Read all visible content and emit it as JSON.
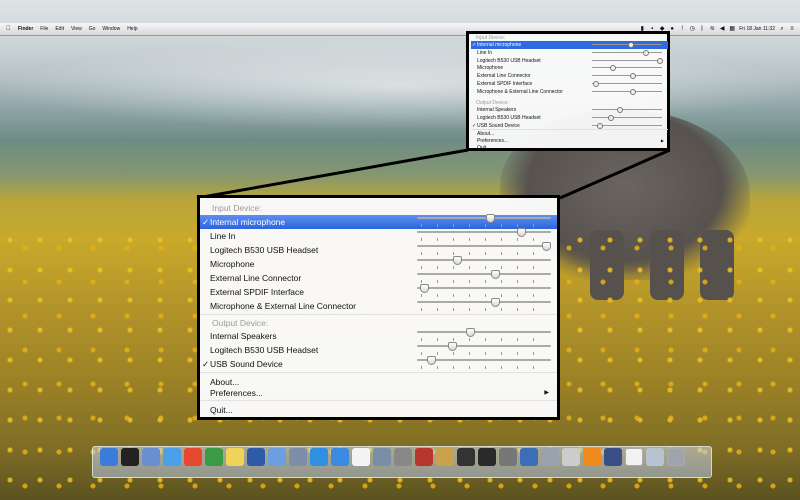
{
  "menubar": {
    "app": "Finder",
    "items": [
      "File",
      "Edit",
      "View",
      "Go",
      "Window",
      "Help"
    ],
    "clock": "Fri 18 Jan  11:32"
  },
  "menu": {
    "input_header": "Input Device:",
    "input_devices": [
      {
        "label": "Internal microphone",
        "checked": true,
        "level": 0.54
      },
      {
        "label": "Line In",
        "checked": false,
        "level": 0.78
      },
      {
        "label": "Logitech B530 USB Headset",
        "checked": false,
        "level": 0.98
      },
      {
        "label": "Microphone",
        "checked": false,
        "level": 0.28
      },
      {
        "label": "External Line Connector",
        "checked": false,
        "level": 0.58
      },
      {
        "label": "External SPDIF Interface",
        "checked": false,
        "level": 0.02
      },
      {
        "label": "Microphone & External Line Connector",
        "checked": false,
        "level": 0.58
      }
    ],
    "output_header": "Output Device:",
    "output_devices": [
      {
        "label": "Internal Speakers",
        "checked": false,
        "level": 0.38
      },
      {
        "label": "Logitech B530 USB Headset",
        "checked": false,
        "level": 0.24
      },
      {
        "label": "USB Sound Device",
        "checked": true,
        "level": 0.08
      }
    ],
    "about": "About...",
    "preferences": "Preferences...",
    "quit": "Quit...",
    "checkmark": "✓",
    "submenu_arrow": "▶"
  },
  "small_menu": {
    "input_header": "Input Device:",
    "output_header": "Output Device:"
  },
  "dock": {
    "icons": [
      "finder-icon",
      "terminal-icon",
      "preview-icon",
      "messages-icon",
      "chrome-icon",
      "evernote-icon",
      "notes-icon",
      "word-icon",
      "folder-icon",
      "mail-icon",
      "safari-icon",
      "app-store-icon",
      "calendar-icon",
      "download-icon",
      "photo-icon",
      "books-icon",
      "preview2-icon",
      "movie-icon",
      "istat-icon",
      "calculator-icon",
      "migration-icon",
      "disk-icon",
      "screenshot-icon",
      "vlc-icon",
      "script-icon",
      "document-icon",
      "mail2-icon",
      "trash-icon"
    ],
    "colors": [
      "#3b7bd9",
      "#222222",
      "#6a8fd0",
      "#4aa0e8",
      "#e5482f",
      "#3a9a46",
      "#f1d35a",
      "#2f5aa8",
      "#6b9fe0",
      "#7d8fa8",
      "#2f8fe0",
      "#3a8be0",
      "#f4f4f4",
      "#7a8fa5",
      "#888888",
      "#b8362c",
      "#c9a24a",
      "#333333",
      "#2a2a2a",
      "#777777",
      "#3b6db8",
      "#9aa3ad",
      "#cccccc",
      "#f08a1c",
      "#3a4f86",
      "#f2f2f2",
      "#b7c3cf",
      "#9ea4aa"
    ]
  }
}
